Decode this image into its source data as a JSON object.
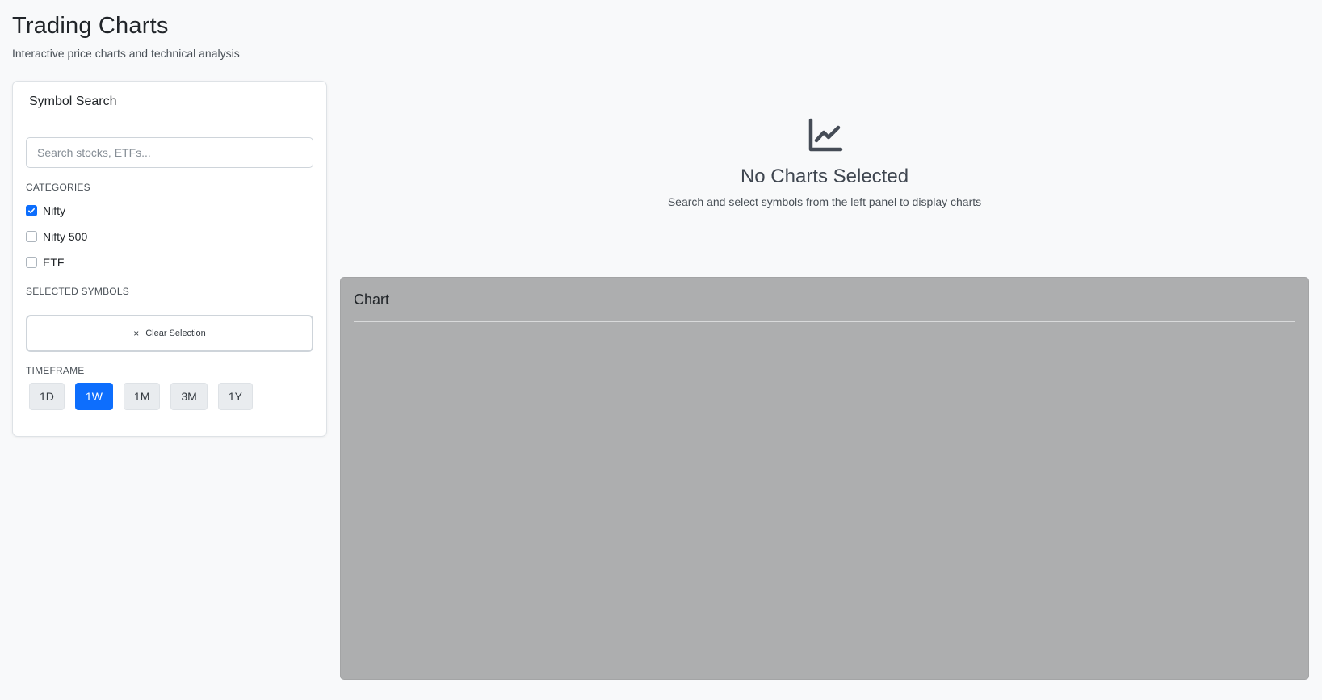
{
  "header": {
    "title": "Trading Charts",
    "subtitle": "Interactive price charts and technical analysis"
  },
  "sidebar": {
    "title": "Symbol Search",
    "search": {
      "placeholder": "Search stocks, ETFs...",
      "value": ""
    },
    "categories_label": "CATEGORIES",
    "categories": [
      {
        "label": "Nifty",
        "checked": true
      },
      {
        "label": "Nifty 500",
        "checked": false
      },
      {
        "label": "ETF",
        "checked": false
      }
    ],
    "selected_label": "SELECTED SYMBOLS",
    "clear_icon": "×",
    "clear_label": "Clear Selection",
    "timeframe_label": "TIMEFRAME",
    "timeframes": [
      {
        "label": "1D",
        "active": false
      },
      {
        "label": "1W",
        "active": true
      },
      {
        "label": "1M",
        "active": false
      },
      {
        "label": "3M",
        "active": false
      },
      {
        "label": "1Y",
        "active": false
      }
    ]
  },
  "empty_state": {
    "icon": "line-chart-icon",
    "title": "No Charts Selected",
    "description": "Search and select symbols from the left panel to display charts"
  },
  "chart_panel": {
    "title": "Chart"
  },
  "colors": {
    "accent": "#0d6efd",
    "page_bg": "#f8f9fa",
    "chart_panel_bg": "#adaeaf"
  }
}
